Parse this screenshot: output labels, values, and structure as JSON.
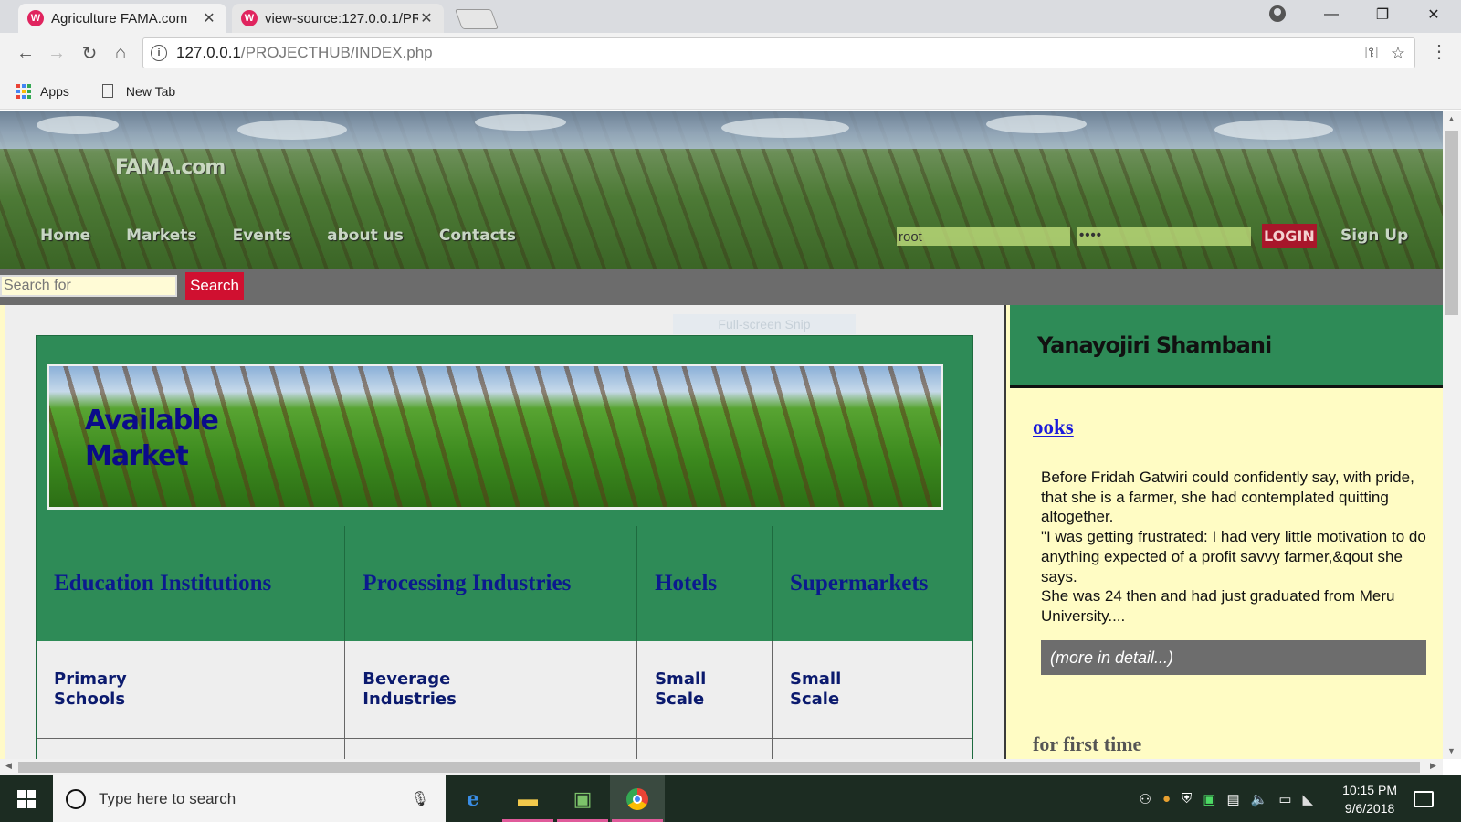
{
  "browser": {
    "tabs": [
      {
        "title": "Agriculture FAMA.com",
        "active": true
      },
      {
        "title": "view-source:127.0.0.1/PR",
        "active": false
      }
    ],
    "url_host": "127.0.0.1",
    "url_path": "/PROJECTHUB/INDEX.php",
    "bookmarks": [
      {
        "label": "Apps",
        "icon": "apps-grid-icon"
      },
      {
        "label": "New Tab",
        "icon": "page-icon"
      }
    ]
  },
  "site": {
    "logo": "FAMA.com",
    "nav": [
      "Home",
      "Markets",
      "Events",
      "about us",
      "Contacts"
    ],
    "login": {
      "username": "root",
      "password_mask": "••••",
      "button": "LOGIN",
      "signup": "Sign Up"
    },
    "search": {
      "placeholder": "Search for",
      "button": "Search"
    }
  },
  "overlay": {
    "snip_label": "Full-screen Snip"
  },
  "markets": {
    "banner_title_line1": "Available",
    "banner_title_line2": "Market",
    "categories": [
      "Education Institutions",
      "Processing Industries",
      "Hotels",
      "Supermarkets"
    ],
    "subcategories": [
      "Primary Schools",
      "Beverage Industries",
      "Small Scale",
      "Small Scale"
    ]
  },
  "sidebar": {
    "heading": "Yanayojiri Shambani",
    "link": "ooks",
    "body_lines": [
      "Before Fridah Gatwiri could confidently say, with pride, that she is a farmer, she had contemplated quitting altogether.",
      "\"I was getting frustrated: I had very little motivation to do anything expected of a profit savvy farmer,&qout she says.",
      "She was 24 then and had just graduated from Meru University...."
    ],
    "more": "(more in detail...)",
    "next_heading_partial": "for first time"
  },
  "taskbar": {
    "search_placeholder": "Type here to search",
    "time": "10:15 PM",
    "date": "9/6/2018"
  },
  "colors": {
    "green": "#2e8b57",
    "sidebar_bg": "#fffcc4",
    "search_btn": "#d01030",
    "login_btn": "#a8162a",
    "link_blue": "#1a1adb",
    "category_blue": "#0b1a8e"
  }
}
